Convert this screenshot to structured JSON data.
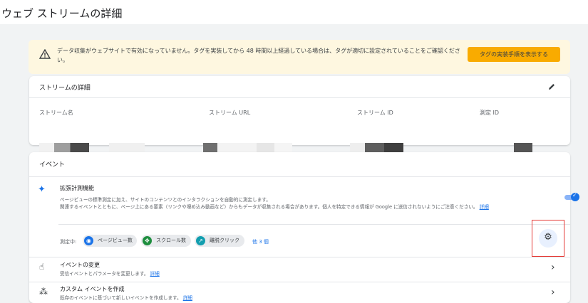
{
  "page": {
    "title": "ウェブ ストリームの詳細"
  },
  "banner": {
    "message": "データ収集がウェブサイトで有効になっていません。タグを実装してから 48 時間以上経過している場合は、タグが適切に設定されていることをご確認ください。",
    "button_label": "タグの実装手順を表示する",
    "icon": "warning-icon"
  },
  "stream_details": {
    "title": "ストリームの詳細",
    "edit_icon": "pencil-icon",
    "fields": [
      {
        "label": "ストリーム名"
      },
      {
        "label": "ストリーム URL"
      },
      {
        "label": "ストリーム ID"
      },
      {
        "label": "測定 ID"
      }
    ]
  },
  "events": {
    "title": "イベント",
    "enhanced": {
      "title": "拡張計測機能",
      "desc_line1": "ページビューの標準測定に加え、サイトのコンテンツとのインタラクションを自動的に測定します。",
      "desc_line2": "関連するイベントとともに、ページ上にある要素（リンクや埋め込み動画など）からもデータが収集される場合があります。個人を特定できる情報が Google に送信されないようにご注意ください。",
      "desc_link": "詳細",
      "enabled": true,
      "measuring_label": "測定中:",
      "chips": [
        {
          "label": "ページビュー数",
          "color": "#1a73e8",
          "icon": "eye-icon"
        },
        {
          "label": "スクロール数",
          "color": "#1e8e3e",
          "icon": "move-icon"
        },
        {
          "label": "離脱クリック",
          "color": "#129eaf",
          "icon": "click-icon"
        }
      ],
      "more_link": "他 3 個"
    },
    "rows": [
      {
        "title": "イベントの変更",
        "desc": "受信イベントとパラメータを変更します。",
        "link": "詳細",
        "icon": "touch-icon"
      },
      {
        "title": "カスタム イベントを作成",
        "desc": "既存のイベントに基づいて新しいイベントを作成します。",
        "link": "詳細",
        "icon": "sparkle-click-icon"
      }
    ]
  },
  "colors": {
    "accent": "#1a73e8",
    "banner_bg": "#fef7e0",
    "banner_button": "#f9ab00",
    "highlight_border": "#e53935"
  }
}
